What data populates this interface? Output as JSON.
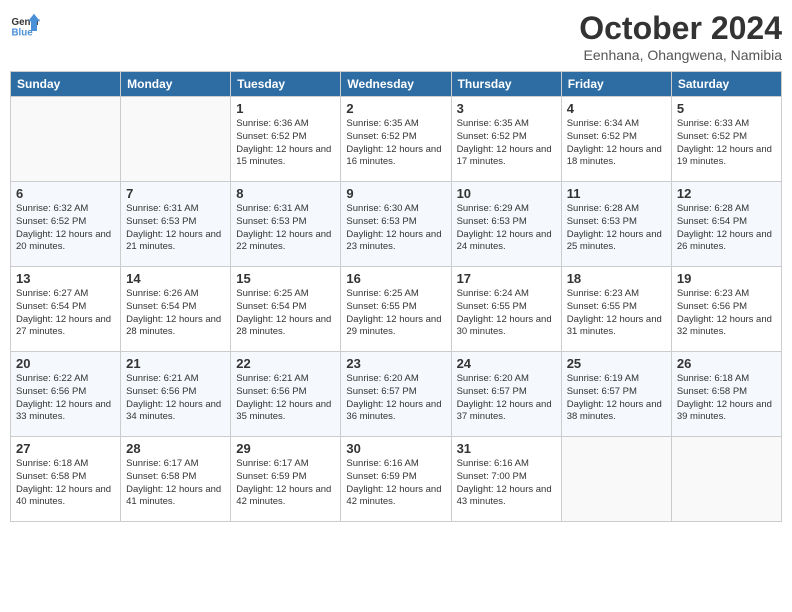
{
  "header": {
    "logo_line1": "General",
    "logo_line2": "Blue",
    "month": "October 2024",
    "location": "Eenhana, Ohangwena, Namibia"
  },
  "days_of_week": [
    "Sunday",
    "Monday",
    "Tuesday",
    "Wednesday",
    "Thursday",
    "Friday",
    "Saturday"
  ],
  "weeks": [
    [
      {
        "day": "",
        "info": ""
      },
      {
        "day": "",
        "info": ""
      },
      {
        "day": "1",
        "info": "Sunrise: 6:36 AM\nSunset: 6:52 PM\nDaylight: 12 hours and 15 minutes."
      },
      {
        "day": "2",
        "info": "Sunrise: 6:35 AM\nSunset: 6:52 PM\nDaylight: 12 hours and 16 minutes."
      },
      {
        "day": "3",
        "info": "Sunrise: 6:35 AM\nSunset: 6:52 PM\nDaylight: 12 hours and 17 minutes."
      },
      {
        "day": "4",
        "info": "Sunrise: 6:34 AM\nSunset: 6:52 PM\nDaylight: 12 hours and 18 minutes."
      },
      {
        "day": "5",
        "info": "Sunrise: 6:33 AM\nSunset: 6:52 PM\nDaylight: 12 hours and 19 minutes."
      }
    ],
    [
      {
        "day": "6",
        "info": "Sunrise: 6:32 AM\nSunset: 6:52 PM\nDaylight: 12 hours and 20 minutes."
      },
      {
        "day": "7",
        "info": "Sunrise: 6:31 AM\nSunset: 6:53 PM\nDaylight: 12 hours and 21 minutes."
      },
      {
        "day": "8",
        "info": "Sunrise: 6:31 AM\nSunset: 6:53 PM\nDaylight: 12 hours and 22 minutes."
      },
      {
        "day": "9",
        "info": "Sunrise: 6:30 AM\nSunset: 6:53 PM\nDaylight: 12 hours and 23 minutes."
      },
      {
        "day": "10",
        "info": "Sunrise: 6:29 AM\nSunset: 6:53 PM\nDaylight: 12 hours and 24 minutes."
      },
      {
        "day": "11",
        "info": "Sunrise: 6:28 AM\nSunset: 6:53 PM\nDaylight: 12 hours and 25 minutes."
      },
      {
        "day": "12",
        "info": "Sunrise: 6:28 AM\nSunset: 6:54 PM\nDaylight: 12 hours and 26 minutes."
      }
    ],
    [
      {
        "day": "13",
        "info": "Sunrise: 6:27 AM\nSunset: 6:54 PM\nDaylight: 12 hours and 27 minutes."
      },
      {
        "day": "14",
        "info": "Sunrise: 6:26 AM\nSunset: 6:54 PM\nDaylight: 12 hours and 28 minutes."
      },
      {
        "day": "15",
        "info": "Sunrise: 6:25 AM\nSunset: 6:54 PM\nDaylight: 12 hours and 28 minutes."
      },
      {
        "day": "16",
        "info": "Sunrise: 6:25 AM\nSunset: 6:55 PM\nDaylight: 12 hours and 29 minutes."
      },
      {
        "day": "17",
        "info": "Sunrise: 6:24 AM\nSunset: 6:55 PM\nDaylight: 12 hours and 30 minutes."
      },
      {
        "day": "18",
        "info": "Sunrise: 6:23 AM\nSunset: 6:55 PM\nDaylight: 12 hours and 31 minutes."
      },
      {
        "day": "19",
        "info": "Sunrise: 6:23 AM\nSunset: 6:56 PM\nDaylight: 12 hours and 32 minutes."
      }
    ],
    [
      {
        "day": "20",
        "info": "Sunrise: 6:22 AM\nSunset: 6:56 PM\nDaylight: 12 hours and 33 minutes."
      },
      {
        "day": "21",
        "info": "Sunrise: 6:21 AM\nSunset: 6:56 PM\nDaylight: 12 hours and 34 minutes."
      },
      {
        "day": "22",
        "info": "Sunrise: 6:21 AM\nSunset: 6:56 PM\nDaylight: 12 hours and 35 minutes."
      },
      {
        "day": "23",
        "info": "Sunrise: 6:20 AM\nSunset: 6:57 PM\nDaylight: 12 hours and 36 minutes."
      },
      {
        "day": "24",
        "info": "Sunrise: 6:20 AM\nSunset: 6:57 PM\nDaylight: 12 hours and 37 minutes."
      },
      {
        "day": "25",
        "info": "Sunrise: 6:19 AM\nSunset: 6:57 PM\nDaylight: 12 hours and 38 minutes."
      },
      {
        "day": "26",
        "info": "Sunrise: 6:18 AM\nSunset: 6:58 PM\nDaylight: 12 hours and 39 minutes."
      }
    ],
    [
      {
        "day": "27",
        "info": "Sunrise: 6:18 AM\nSunset: 6:58 PM\nDaylight: 12 hours and 40 minutes."
      },
      {
        "day": "28",
        "info": "Sunrise: 6:17 AM\nSunset: 6:58 PM\nDaylight: 12 hours and 41 minutes."
      },
      {
        "day": "29",
        "info": "Sunrise: 6:17 AM\nSunset: 6:59 PM\nDaylight: 12 hours and 42 minutes."
      },
      {
        "day": "30",
        "info": "Sunrise: 6:16 AM\nSunset: 6:59 PM\nDaylight: 12 hours and 42 minutes."
      },
      {
        "day": "31",
        "info": "Sunrise: 6:16 AM\nSunset: 7:00 PM\nDaylight: 12 hours and 43 minutes."
      },
      {
        "day": "",
        "info": ""
      },
      {
        "day": "",
        "info": ""
      }
    ]
  ]
}
